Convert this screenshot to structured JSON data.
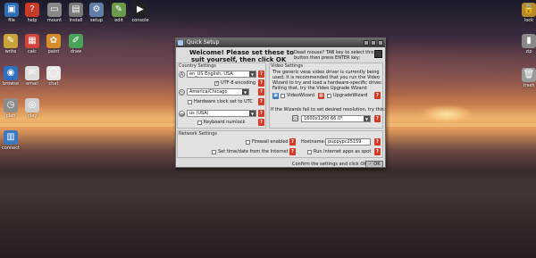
{
  "desktop": {
    "icons": [
      {
        "label": "file",
        "glyph": "▣",
        "color": "#2c6db3"
      },
      {
        "label": "help",
        "glyph": "?",
        "color": "#c83b2b"
      },
      {
        "label": "mount",
        "glyph": "▭",
        "color": "#888888"
      },
      {
        "label": "install",
        "glyph": "▤",
        "color": "#7a7a7a"
      },
      {
        "label": "setup",
        "glyph": "⚙",
        "color": "#5f7ea8"
      },
      {
        "label": "edit",
        "glyph": "✎",
        "color": "#6a9a4a"
      },
      {
        "label": "console",
        "glyph": "▶",
        "color": "#222222"
      },
      {
        "label": "lock",
        "glyph": "🔒",
        "color": "#b8892a"
      },
      {
        "label": "write",
        "glyph": "✎",
        "color": "#caa43a"
      },
      {
        "label": "calc",
        "glyph": "▦",
        "color": "#d0463c"
      },
      {
        "label": "paint",
        "glyph": "✿",
        "color": "#d88c2a"
      },
      {
        "label": "draw",
        "glyph": "✐",
        "color": "#4aa35a"
      },
      {
        "label": "zip",
        "glyph": "▮",
        "color": "#8a8a8a"
      },
      {
        "label": "browse",
        "glyph": "◉",
        "color": "#2f6fc0"
      },
      {
        "label": "email",
        "glyph": "✉",
        "color": "#dedede"
      },
      {
        "label": "chat",
        "glyph": "◯",
        "color": "#e8e8e8"
      },
      {
        "label": "trash",
        "glyph": "🗑",
        "color": "#9a9a9a"
      },
      {
        "label": "plan",
        "glyph": "◷",
        "color": "#8c8c8c"
      },
      {
        "label": "play",
        "glyph": "◎",
        "color": "#cfcfcf"
      },
      {
        "label": "connect",
        "glyph": "▥",
        "color": "#3a78c0"
      }
    ]
  },
  "window": {
    "title": "Quick Setup",
    "heading_line1": "Welcome! Please set these to",
    "heading_line2": "suit yourself, then click OK",
    "dead_mouse_line1": "Dead mouse? TAB key to select this",
    "dead_mouse_line2": "button then press ENTER key:",
    "country": {
      "header": "Country Settings",
      "locale_value": "en_US      English, USA",
      "utf8_label": "UTF-8 encoding",
      "timezone_value": "America/Chicago",
      "hw_clock_label": "Hardware clock set to UTC",
      "keyboard_value": "us            (USA)",
      "numlock_label": "Keyboard numlock"
    },
    "video": {
      "header": "Video Settings",
      "info_line1": "The generic vesa video driver is currently being",
      "info_line2": "used. It is recommended that you run the Video",
      "info_line3": "Wizard to try and load a hardware-specific driver.",
      "info_line4": "Failing that, try the Video Upgrade Wizard:",
      "wizard_label": "VideoWizard",
      "upgrade_label": "UpgradeWizard",
      "resolution_hint": "If the Wizards fail to set desired resolution, try this:",
      "resolution_value": "1600x1200      66.0*"
    },
    "network": {
      "header": "Network Settings",
      "firewall_label": "Firewall enabled",
      "hostname_label": "Hostname:",
      "hostname_value": "puppypc25159",
      "time_label": "Set time/date from the Internet",
      "internet_apps_label": "Run Internet apps as spot"
    },
    "confirm_text": "Confirm the settings and click OK:",
    "ok_label": "OK"
  }
}
